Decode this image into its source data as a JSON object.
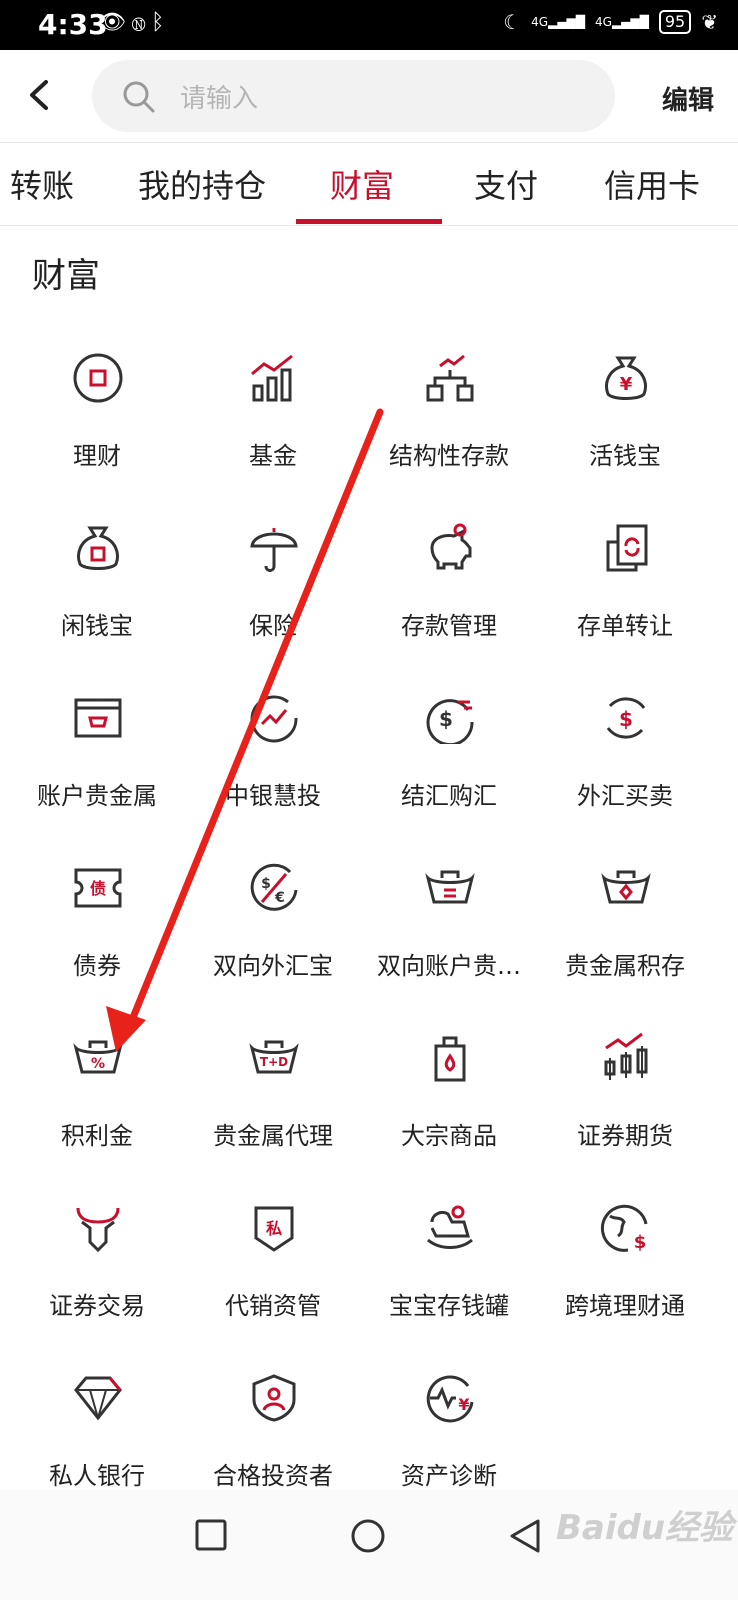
{
  "status": {
    "time": "4:33",
    "battery": "95",
    "network_1": "4G",
    "network_2": "4G"
  },
  "search": {
    "placeholder": "请输入"
  },
  "header": {
    "edit_label": "编辑"
  },
  "tabs": [
    {
      "label": "转账"
    },
    {
      "label": "我的持仓"
    },
    {
      "label": "财富",
      "active": true
    },
    {
      "label": "支付"
    },
    {
      "label": "信用卡"
    }
  ],
  "section": {
    "title": "财富"
  },
  "items": [
    {
      "label": "理财",
      "icon": "coin-icon"
    },
    {
      "label": "基金",
      "icon": "bar-chart-icon"
    },
    {
      "label": "结构性存款",
      "icon": "structure-icon"
    },
    {
      "label": "活钱宝",
      "icon": "money-bag-yen-icon"
    },
    {
      "label": "闲钱宝",
      "icon": "money-bag-icon"
    },
    {
      "label": "保险",
      "icon": "umbrella-icon"
    },
    {
      "label": "存款管理",
      "icon": "piggy-bank-icon"
    },
    {
      "label": "存单转让",
      "icon": "certificate-transfer-icon"
    },
    {
      "label": "账户贵金属",
      "icon": "gold-card-icon"
    },
    {
      "label": "中银慧投",
      "icon": "smart-invest-icon"
    },
    {
      "label": "结汇购汇",
      "icon": "dollar-exchange-icon"
    },
    {
      "label": "外汇买卖",
      "icon": "dollar-cycle-icon"
    },
    {
      "label": "债券",
      "icon": "bond-ticket-icon"
    },
    {
      "label": "双向外汇宝",
      "icon": "dollar-euro-icon"
    },
    {
      "label": "双向账户贵…",
      "icon": "ingot-exchange-icon"
    },
    {
      "label": "贵金属积存",
      "icon": "ingot-diamond-icon"
    },
    {
      "label": "积利金",
      "icon": "ingot-percent-icon"
    },
    {
      "label": "贵金属代理",
      "icon": "ingot-td-icon"
    },
    {
      "label": "大宗商品",
      "icon": "oil-can-icon"
    },
    {
      "label": "证券期货",
      "icon": "candlestick-icon"
    },
    {
      "label": "证券交易",
      "icon": "bull-icon"
    },
    {
      "label": "代销资管",
      "icon": "private-shield-icon"
    },
    {
      "label": "宝宝存钱罐",
      "icon": "rocking-horse-icon"
    },
    {
      "label": "跨境理财通",
      "icon": "globe-dollar-icon"
    },
    {
      "label": "私人银行",
      "icon": "diamond-icon"
    },
    {
      "label": "合格投资者",
      "icon": "investor-shield-icon"
    },
    {
      "label": "资产诊断",
      "icon": "asset-diagnosis-icon"
    }
  ],
  "watermark": {
    "text": "Baidu经验"
  },
  "colors": {
    "accent": "#c8102e",
    "icon_dark": "#333333"
  }
}
